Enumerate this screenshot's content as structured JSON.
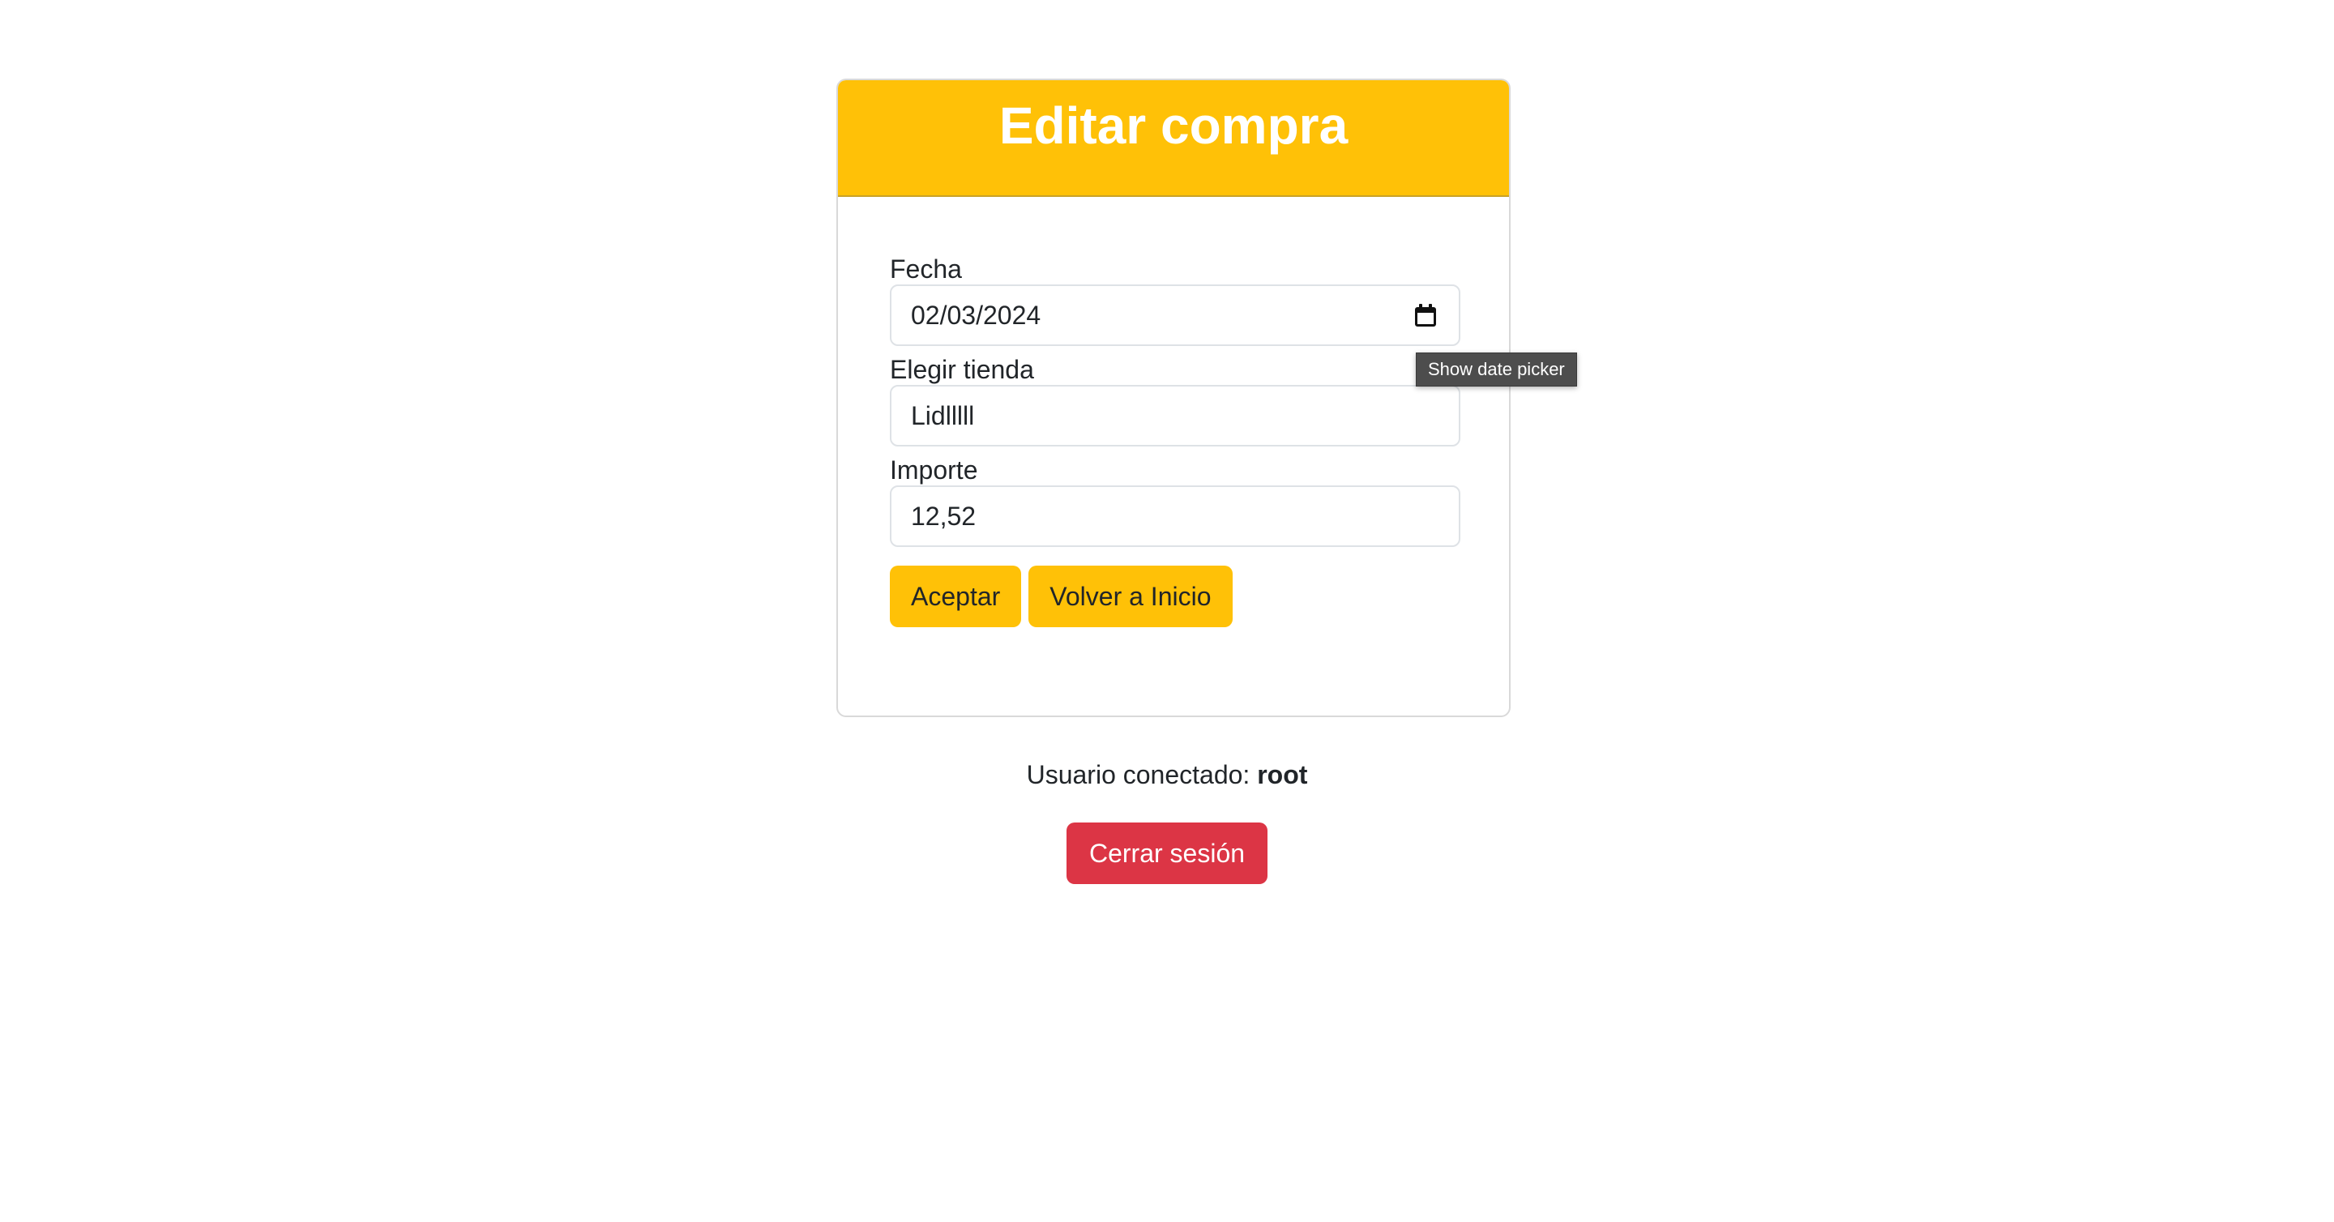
{
  "page": {
    "heading": "Editar compra"
  },
  "form": {
    "fecha": {
      "label": "Fecha",
      "value": "02/03/2024",
      "icon": "calendar-icon"
    },
    "tienda": {
      "label": "Elegir tienda",
      "value": "Lidlllll"
    },
    "importe": {
      "label": "Importe",
      "value": "12,52"
    },
    "accept_label": "Aceptar",
    "back_label": "Volver a Inicio"
  },
  "tooltip": {
    "text": "Show date picker"
  },
  "user": {
    "prefix": "Usuario conectado: ",
    "name": "root"
  },
  "logout": {
    "label": "Cerrar sesión"
  },
  "colors": {
    "warning": "#ffc107",
    "danger": "#dc3545"
  }
}
